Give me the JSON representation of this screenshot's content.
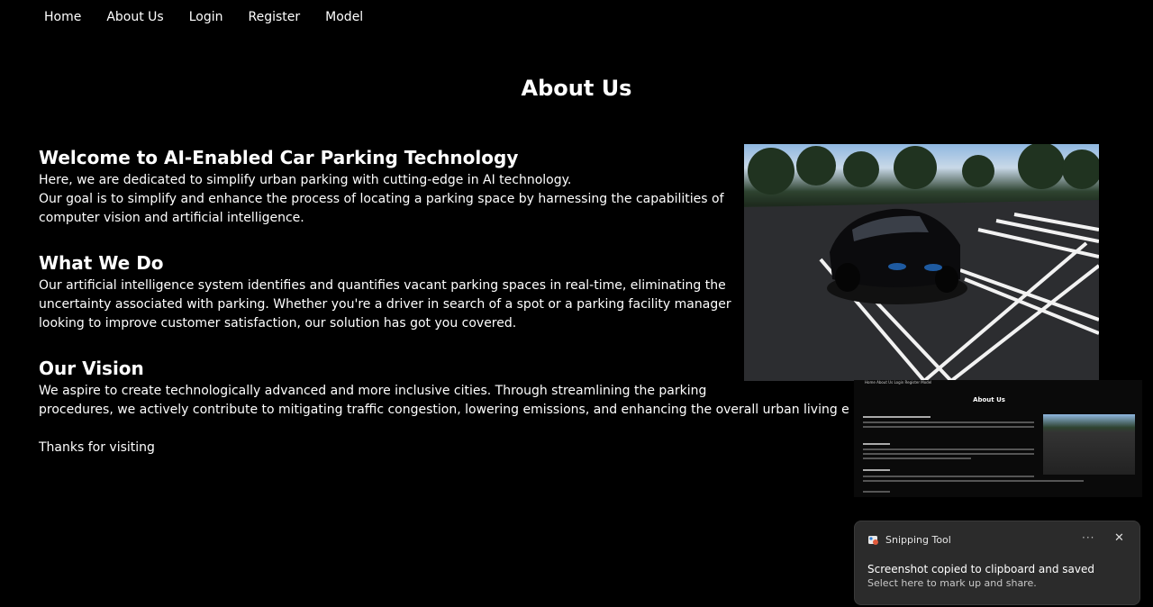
{
  "nav": {
    "items": [
      {
        "label": "Home"
      },
      {
        "label": "About Us"
      },
      {
        "label": "Login"
      },
      {
        "label": "Register"
      },
      {
        "label": "Model"
      }
    ]
  },
  "page_title": "About Us",
  "sections": {
    "welcome": {
      "heading": "Welcome to AI-Enabled Car Parking Technology",
      "line1": "Here, we are dedicated to simplify urban parking with cutting-edge in AI technology.",
      "line2": "Our goal is to simplify and enhance the process of locating a parking space by harnessing the capabilities of computer vision and artificial intelligence."
    },
    "what_we_do": {
      "heading": "What We Do",
      "body": "Our artificial intelligence system identifies and quantifies vacant parking spaces in real-time, eliminating the uncertainty associated with parking. Whether you're a driver in search of a spot or a parking facility manager looking to improve customer satisfaction, our solution has got you covered."
    },
    "vision": {
      "heading": "Our Vision",
      "line1": "We aspire to create technologically advanced and more inclusive cities. Through streamlining the parking",
      "line2": "procedures, we actively contribute to mitigating traffic congestion, lowering emissions, and enhancing the overall urban living experience."
    },
    "thanks": "Thanks for visiting"
  },
  "thumbnail": {
    "nav": "Home   About Us   Login   Register   Model",
    "title": "About Us"
  },
  "toast": {
    "app_name": "Snipping Tool",
    "more_label": "···",
    "close_label": "✕",
    "title": "Screenshot copied to clipboard and saved",
    "subtitle": "Select here to mark up and share."
  },
  "icons": {
    "hero": "parking-lot-car-photo",
    "app": "snipping-tool-icon"
  }
}
